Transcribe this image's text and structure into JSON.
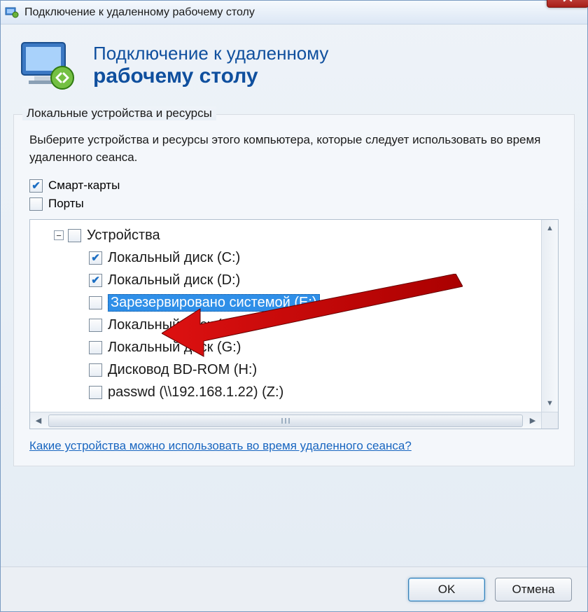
{
  "window": {
    "title": "Подключение к удаленному рабочему столу"
  },
  "header": {
    "line1": "Подключение к удаленному",
    "line2": "рабочему столу"
  },
  "group": {
    "label": "Локальные устройства и ресурсы",
    "instruction": "Выберите устройства и ресурсы этого компьютера, которые следует использовать во время удаленного сеанса.",
    "checkboxes": [
      {
        "label": "Смарт-карты",
        "checked": true
      },
      {
        "label": "Порты",
        "checked": false
      }
    ],
    "tree": {
      "root": {
        "label": "Устройства",
        "checked": false,
        "expanded": true
      },
      "items": [
        {
          "label": "Локальный диск (C:)",
          "checked": true,
          "selected": false
        },
        {
          "label": "Локальный диск (D:)",
          "checked": true,
          "selected": false
        },
        {
          "label": "Зарезервировано системой (E:)",
          "checked": false,
          "selected": true
        },
        {
          "label": "Локальный диск (F:)",
          "checked": false,
          "selected": false
        },
        {
          "label": "Локальный диск (G:)",
          "checked": false,
          "selected": false
        },
        {
          "label": "Дисковод BD-ROM (H:)",
          "checked": false,
          "selected": false
        },
        {
          "label": "passwd (\\\\192.168.1.22) (Z:)",
          "checked": false,
          "selected": false
        }
      ]
    },
    "help_link": "Какие устройства можно использовать во время удаленного сеанса?"
  },
  "footer": {
    "ok": "OK",
    "cancel": "Отмена"
  }
}
